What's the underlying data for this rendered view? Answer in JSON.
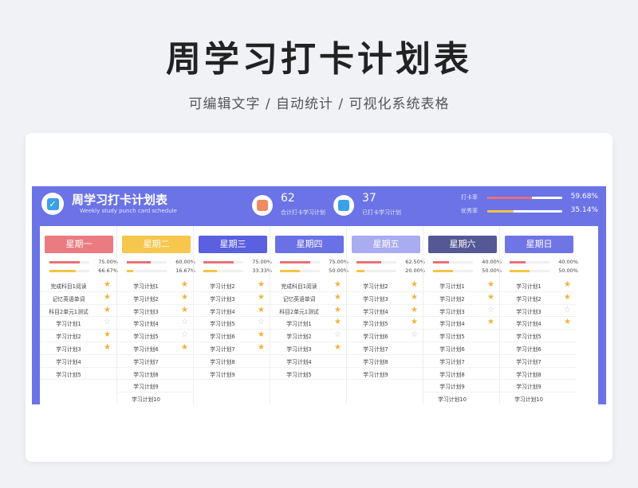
{
  "banner": {
    "title": "周学习打卡计划表",
    "subtitle": "可编辑文字 / 自动统计 / 可视化系统表格"
  },
  "sheet": {
    "title": "周学习打卡计划表",
    "subtitle": "Weekly study punch card schedule",
    "stats": [
      {
        "value": "62",
        "label": "合计打卡学习计划",
        "icon": "calendar-icon",
        "color": "#f08a63"
      },
      {
        "value": "37",
        "label": "已打卡学习计划",
        "icon": "heart-check-icon",
        "color": "#3aa0e8"
      }
    ],
    "rates": [
      {
        "label": "打卡率",
        "value": "59.68%",
        "fraction": 0.5968,
        "color": "#e8707a"
      },
      {
        "label": "优秀率",
        "value": "35.14%",
        "fraction": 0.3514,
        "color": "#f5c444"
      }
    ]
  },
  "days": [
    {
      "name": "星期一",
      "color": "#eb7b80",
      "rate1": {
        "value": "75.00%",
        "fraction": 0.75,
        "color": "#e8707a"
      },
      "rate2": {
        "value": "66.67%",
        "fraction": 0.6667,
        "color": "#f5c444"
      },
      "tasks": [
        {
          "text": "完成科目1阅读",
          "star": "on"
        },
        {
          "text": "记忆英语单词",
          "star": "on"
        },
        {
          "text": "科目2单元1测试",
          "star": "on"
        },
        {
          "text": "学习计划1",
          "star": "off"
        },
        {
          "text": "学习计划2",
          "star": "on"
        },
        {
          "text": "学习计划3",
          "star": "on"
        },
        {
          "text": "学习计划4",
          "star": "none"
        },
        {
          "text": "学习计划5",
          "star": "none"
        }
      ]
    },
    {
      "name": "星期二",
      "color": "#f7c64c",
      "rate1": {
        "value": "60.00%",
        "fraction": 0.6,
        "color": "#e8707a"
      },
      "rate2": {
        "value": "16.67%",
        "fraction": 0.1667,
        "color": "#f5c444"
      },
      "tasks": [
        {
          "text": "学习计划1",
          "star": "on"
        },
        {
          "text": "学习计划2",
          "star": "on"
        },
        {
          "text": "学习计划3",
          "star": "on"
        },
        {
          "text": "学习计划4",
          "star": "off"
        },
        {
          "text": "学习计划5",
          "star": "off"
        },
        {
          "text": "学习计划6",
          "star": "on"
        },
        {
          "text": "学习计划7",
          "star": "none"
        },
        {
          "text": "学习计划8",
          "star": "none"
        },
        {
          "text": "学习计划9",
          "star": "none"
        },
        {
          "text": "学习计划10",
          "star": "none"
        }
      ]
    },
    {
      "name": "星期三",
      "color": "#5a60e0",
      "rate1": {
        "value": "75.00%",
        "fraction": 0.75,
        "color": "#e8707a"
      },
      "rate2": {
        "value": "33.33%",
        "fraction": 0.3333,
        "color": "#f5c444"
      },
      "tasks": [
        {
          "text": "学习计划2",
          "star": "on"
        },
        {
          "text": "学习计划3",
          "star": "on"
        },
        {
          "text": "学习计划4",
          "star": "on"
        },
        {
          "text": "学习计划5",
          "star": "off"
        },
        {
          "text": "学习计划6",
          "star": "on"
        },
        {
          "text": "学习计划7",
          "star": "on"
        },
        {
          "text": "学习计划8",
          "star": "none"
        },
        {
          "text": "学习计划9",
          "star": "none"
        }
      ]
    },
    {
      "name": "星期四",
      "color": "#6a70e6",
      "rate1": {
        "value": "75.00%",
        "fraction": 0.75,
        "color": "#e8707a"
      },
      "rate2": {
        "value": "50.00%",
        "fraction": 0.5,
        "color": "#f5c444"
      },
      "tasks": [
        {
          "text": "完成科目1阅读",
          "star": "on"
        },
        {
          "text": "记忆英语单词",
          "star": "on"
        },
        {
          "text": "科目2单元1测试",
          "star": "on"
        },
        {
          "text": "学习计划1",
          "star": "on"
        },
        {
          "text": "学习计划2",
          "star": "off"
        },
        {
          "text": "学习计划3",
          "star": "on"
        },
        {
          "text": "学习计划4",
          "star": "none"
        },
        {
          "text": "学习计划5",
          "star": "none"
        }
      ]
    },
    {
      "name": "星期五",
      "color": "#a9acf0",
      "rate1": {
        "value": "62.50%",
        "fraction": 0.625,
        "color": "#e8707a"
      },
      "rate2": {
        "value": "20.00%",
        "fraction": 0.2,
        "color": "#f5c444"
      },
      "tasks": [
        {
          "text": "学习计划2",
          "star": "on"
        },
        {
          "text": "学习计划3",
          "star": "on"
        },
        {
          "text": "学习计划4",
          "star": "on"
        },
        {
          "text": "学习计划5",
          "star": "on"
        },
        {
          "text": "学习计划6",
          "star": "off"
        },
        {
          "text": "学习计划7",
          "star": "none"
        },
        {
          "text": "学习计划8",
          "star": "none"
        },
        {
          "text": "学习计划9",
          "star": "none"
        }
      ]
    },
    {
      "name": "星期六",
      "color": "#555894",
      "rate1": {
        "value": "40.00%",
        "fraction": 0.4,
        "color": "#e8707a"
      },
      "rate2": {
        "value": "50.00%",
        "fraction": 0.5,
        "color": "#f5c444"
      },
      "tasks": [
        {
          "text": "学习计划1",
          "star": "on"
        },
        {
          "text": "学习计划2",
          "star": "on"
        },
        {
          "text": "学习计划3",
          "star": "off"
        },
        {
          "text": "学习计划4",
          "star": "on"
        },
        {
          "text": "学习计划5",
          "star": "none"
        },
        {
          "text": "学习计划6",
          "star": "none"
        },
        {
          "text": "学习计划7",
          "star": "none"
        },
        {
          "text": "学习计划8",
          "star": "none"
        },
        {
          "text": "学习计划9",
          "star": "none"
        },
        {
          "text": "学习计划10",
          "star": "none"
        }
      ]
    },
    {
      "name": "星期日",
      "color": "#7075e6",
      "rate1": {
        "value": "40.00%",
        "fraction": 0.4,
        "color": "#e8707a"
      },
      "rate2": {
        "value": "50.00%",
        "fraction": 0.5,
        "color": "#f5c444"
      },
      "tasks": [
        {
          "text": "学习计划1",
          "star": "on"
        },
        {
          "text": "学习计划2",
          "star": "on"
        },
        {
          "text": "学习计划3",
          "star": "off"
        },
        {
          "text": "学习计划4",
          "star": "on"
        },
        {
          "text": "学习计划5",
          "star": "none"
        },
        {
          "text": "学习计划6",
          "star": "none"
        },
        {
          "text": "学习计划7",
          "star": "none"
        },
        {
          "text": "学习计划8",
          "star": "none"
        },
        {
          "text": "学习计划9",
          "star": "none"
        },
        {
          "text": "学习计划10",
          "star": "none"
        }
      ]
    }
  ]
}
